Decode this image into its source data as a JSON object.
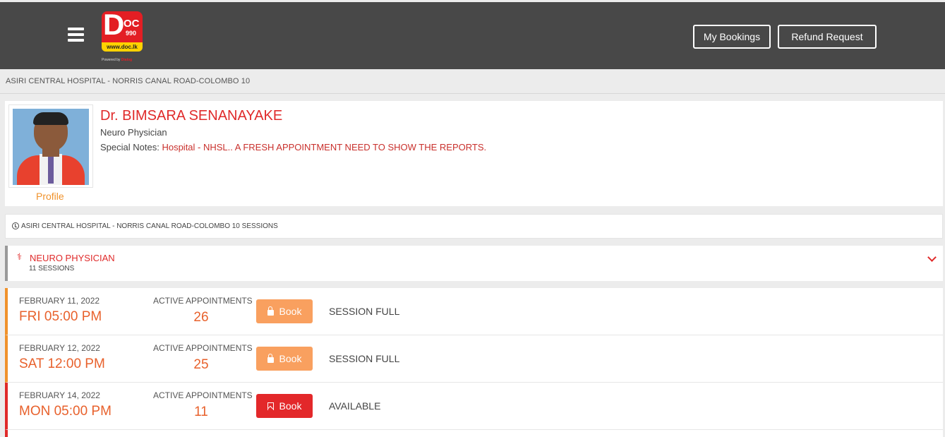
{
  "header": {
    "logo_text_d": "D",
    "logo_text_oc": "OC",
    "logo_text_990": "990",
    "logo_url": "www.doc.lk",
    "logo_powered": "Powered by",
    "logo_powered_brand": "Dialog",
    "my_bookings_label": "My Bookings",
    "refund_request_label": "Refund Request"
  },
  "breadcrumb": "ASIRI CENTRAL HOSPITAL - NORRIS CANAL ROAD-COLOMBO 10",
  "doctor": {
    "name": "Dr. BIMSARA SENANAYAKE",
    "specialization": "Neuro Physician",
    "notes_label": "Special Notes:",
    "notes_value": "Hospital - NHSL.. A FRESH APPOINTMENT NEED TO SHOW THE REPORTS.",
    "profile_label": "Profile"
  },
  "sessions_header": "ASIRI CENTRAL HOSPITAL - NORRIS CANAL ROAD-COLOMBO 10 SESSIONS",
  "specialty_panel": {
    "title": "NEURO PHYSICIAN",
    "count": "11 SESSIONS"
  },
  "sessions": [
    {
      "date": "FEBRUARY 11, 2022",
      "time": "FRI 05:00 PM",
      "active_label": "ACTIVE APPOINTMENTS",
      "active_count": "26",
      "book_label": "Book",
      "status": "SESSION FULL"
    },
    {
      "date": "FEBRUARY 12, 2022",
      "time": "SAT 12:00 PM",
      "active_label": "ACTIVE APPOINTMENTS",
      "active_count": "25",
      "book_label": "Book",
      "status": "SESSION FULL"
    },
    {
      "date": "FEBRUARY 14, 2022",
      "time": "MON 05:00 PM",
      "active_label": "ACTIVE APPOINTMENTS",
      "active_count": "11",
      "book_label": "Book",
      "status": "AVAILABLE"
    }
  ],
  "colors": {
    "topbar": "#484848",
    "accent_red": "#e02a2a",
    "accent_orange": "#f0922b",
    "book_full": "#f9a05f",
    "book_available": "#e3282a"
  }
}
